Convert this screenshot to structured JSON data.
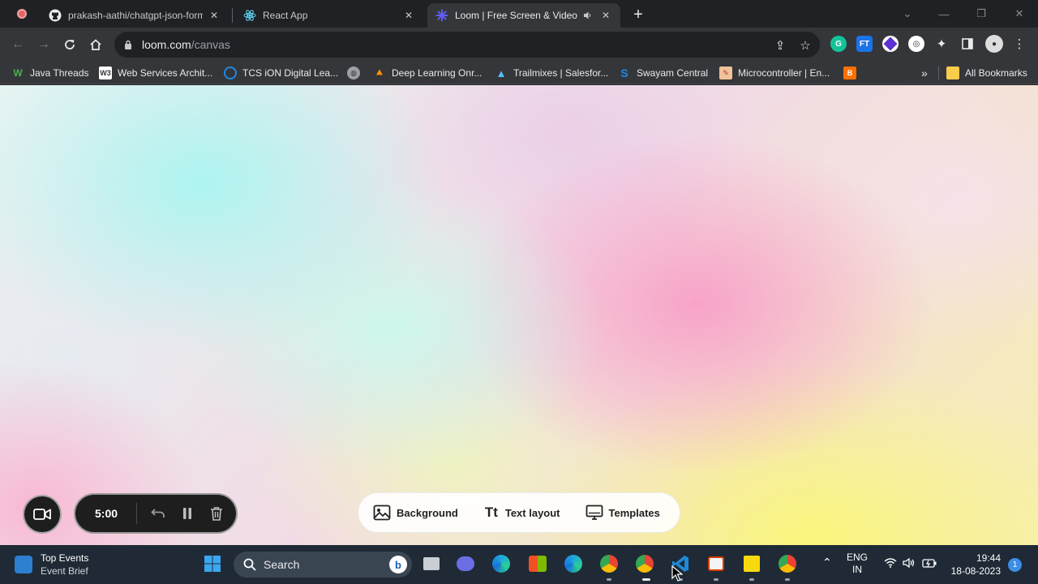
{
  "browser": {
    "tabs": [
      {
        "title": "prakash-aathi/chatgpt-json-form",
        "favicon": "github-icon",
        "active": false
      },
      {
        "title": "React App",
        "favicon": "react-icon",
        "active": false
      },
      {
        "title": "Loom | Free Screen & Video",
        "favicon": "loom-icon",
        "active": true,
        "audio": "speaker-icon"
      }
    ],
    "url_host": "loom.com",
    "url_path": "/canvas"
  },
  "bookmarks": {
    "items": [
      {
        "label": "Java Threads",
        "icon": "w-logo-icon",
        "color": "#2e7d32"
      },
      {
        "label": "Web Services Archit...",
        "icon": "w3-logo-icon",
        "color": "#444444"
      },
      {
        "label": "TCS iON Digital Lea...",
        "icon": "tcs-ion-icon",
        "color": "#1e88e5"
      },
      {
        "label": "",
        "icon": "globe-icon",
        "color": "#9aa0a6"
      },
      {
        "label": "Deep Learning Onr...",
        "icon": "tensorflow-icon",
        "color": "#ff8f00"
      },
      {
        "label": "Trailmixes | Salesfor...",
        "icon": "trailhead-icon",
        "color": "#0b6fd8"
      },
      {
        "label": "Swayam Central",
        "icon": "swayam-icon",
        "color": "#1565c0"
      },
      {
        "label": "Microcontroller | En...",
        "icon": "notebook-icon",
        "color": "#d84315"
      },
      {
        "label": "",
        "icon": "blogger-icon",
        "color": "#ff6f00"
      }
    ],
    "overflow": "»",
    "all_bookmarks": "All Bookmarks"
  },
  "canvas": {
    "timer": "5:00",
    "toolbar": {
      "background": "Background",
      "text_layout": "Text layout",
      "templates": "Templates"
    }
  },
  "taskbar": {
    "weather_title": "Top Events",
    "weather_sub": "Event Brief",
    "search_label": "Search",
    "lang_top": "ENG",
    "lang_bottom": "IN",
    "time": "19:44",
    "date": "18-08-2023",
    "notifications": "1"
  },
  "colors": {
    "chrome_dark": "#202124",
    "chrome_toolbar": "#35363a",
    "taskbar": "#1f2a36",
    "loom_accent": "#625df5"
  }
}
